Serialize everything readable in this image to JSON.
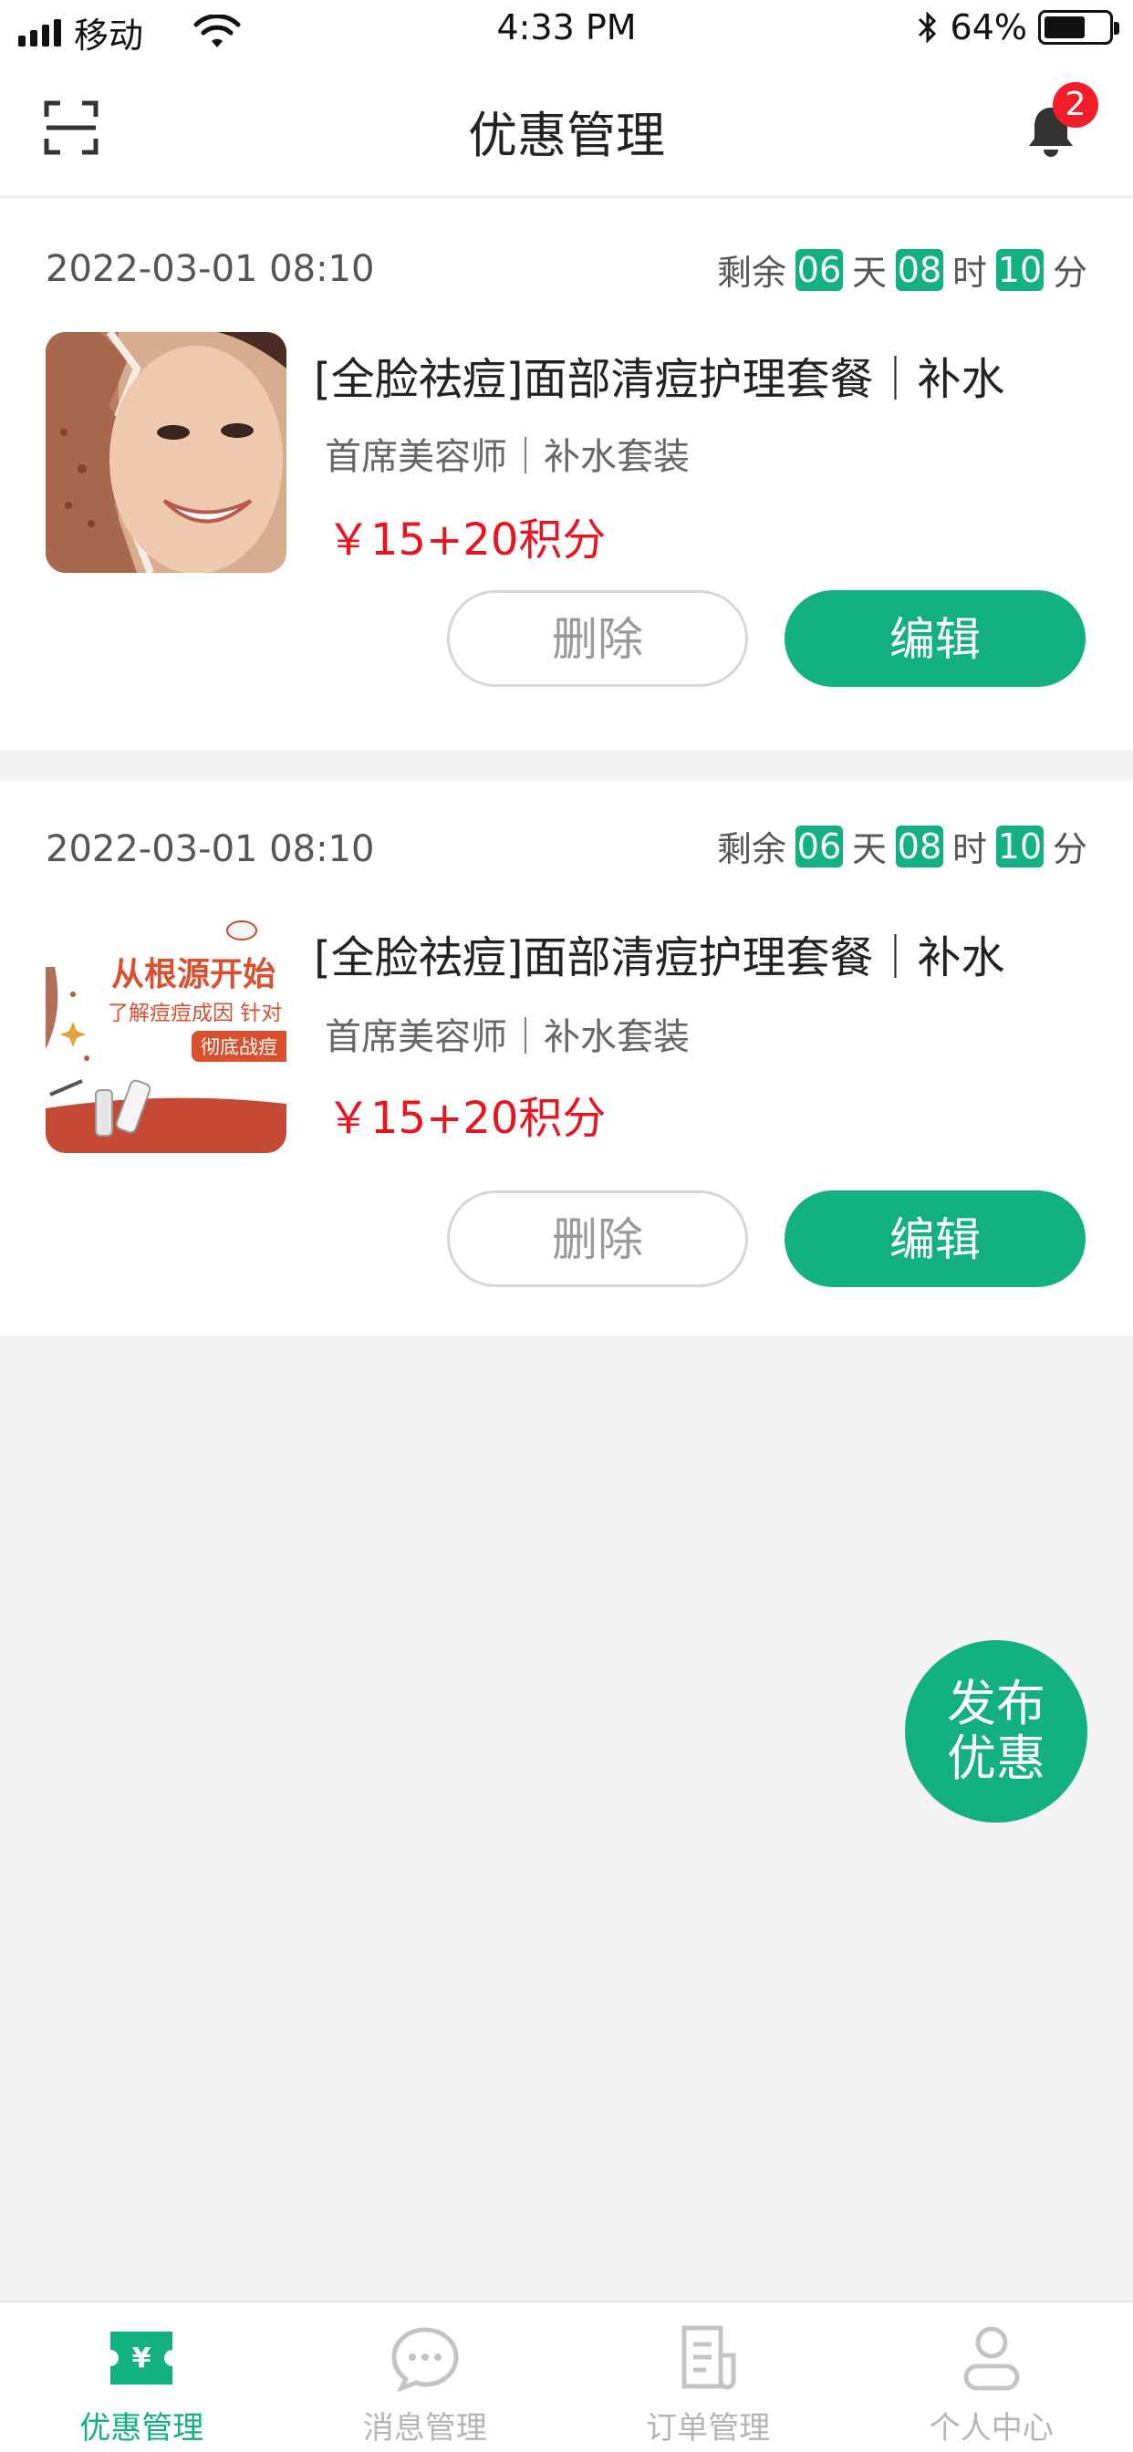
{
  "status_bar": {
    "carrier": "移动",
    "time": "4:33 PM",
    "battery": "64%"
  },
  "nav": {
    "title": "优惠管理",
    "notification_count": "2",
    "icons": {
      "left": "scan-icon",
      "right": "bell-icon"
    }
  },
  "cards": [
    {
      "date": "2022-03-01  08:10",
      "countdown": {
        "prefix": "剩余",
        "days": "06",
        "day_unit": "天",
        "hours": "08",
        "hour_unit": "时",
        "minutes": "10",
        "minute_unit": "分"
      },
      "title": "[全脸祛痘]面部清痘护理套餐｜补水",
      "subtitle": "首席美容师｜补水套装",
      "price": "￥15+20积分",
      "delete_label": "删除",
      "edit_label": "编辑"
    },
    {
      "date": "2022-03-01  08:10",
      "countdown": {
        "prefix": "剩余",
        "days": "06",
        "day_unit": "天",
        "hours": "08",
        "hour_unit": "时",
        "minutes": "10",
        "minute_unit": "分"
      },
      "title": "[全脸祛痘]面部清痘护理套餐｜补水",
      "subtitle": "首席美容师｜补水套装",
      "price": "￥15+20积分",
      "delete_label": "删除",
      "edit_label": "编辑",
      "thumb_text": {
        "line1": "从根源开始",
        "line2": "了解痘痘成因 针对",
        "line3": "彻底战痘"
      }
    }
  ],
  "fab": {
    "line1": "发布",
    "line2": "优惠"
  },
  "tabs": [
    {
      "label": "优惠管理",
      "icon": "coupon-icon",
      "active": true
    },
    {
      "label": "消息管理",
      "icon": "chat-icon",
      "active": false
    },
    {
      "label": "订单管理",
      "icon": "order-icon",
      "active": false
    },
    {
      "label": "个人中心",
      "icon": "user-icon",
      "active": false
    }
  ],
  "colors": {
    "primary": "#13b081",
    "price": "#e8141e",
    "badge": "#f21d2a",
    "background": "#f3f3f3"
  }
}
